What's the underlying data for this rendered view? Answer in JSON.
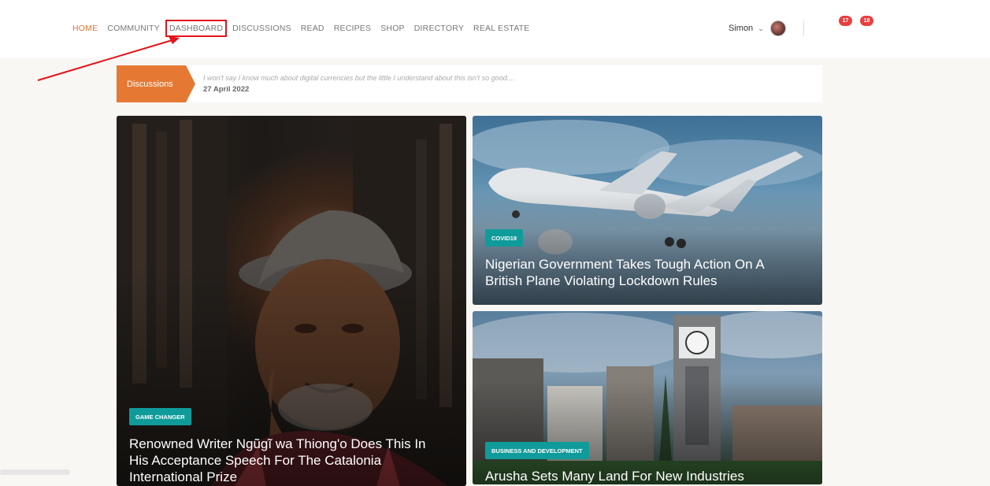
{
  "nav": {
    "items": [
      {
        "label": "HOME",
        "active": true
      },
      {
        "label": "COMMUNITY",
        "active": false
      },
      {
        "label": "DASHBOARD",
        "active": false,
        "highlighted": true
      },
      {
        "label": "DISCUSSIONS",
        "active": false
      },
      {
        "label": "READ",
        "active": false
      },
      {
        "label": "RECIPES",
        "active": false
      },
      {
        "label": "SHOP",
        "active": false
      },
      {
        "label": "DIRECTORY",
        "active": false
      },
      {
        "label": "REAL ESTATE",
        "active": false
      }
    ]
  },
  "user": {
    "name": "Simon",
    "chevron": "chevron-down-icon",
    "notifications": [
      {
        "count": "17"
      },
      {
        "count": "18"
      }
    ]
  },
  "colors": {
    "accent": "#e57934",
    "badge": "#e54141",
    "tag": "#109b9b",
    "highlight_box": "#e3141a"
  },
  "ticker": {
    "label": "Discussions",
    "text": "I won't say I know much about digital currencies but the little I understand about this isn't so good....",
    "date": "27 April 2022"
  },
  "cards": {
    "main": {
      "tag": "GAME CHANGER",
      "headline": "Renowned Writer Ngũgĩ wa Thiong'o Does This In His Acceptance Speech For The Catalonia International Prize"
    },
    "plane": {
      "tag": "COVID19",
      "headline": "Nigerian Government Takes Tough Action On A British Plane Violating Lockdown Rules"
    },
    "clock": {
      "tag": "BUSINESS AND DEVELOPMENT",
      "headline": "Arusha Sets Many Land For New Industries"
    }
  }
}
